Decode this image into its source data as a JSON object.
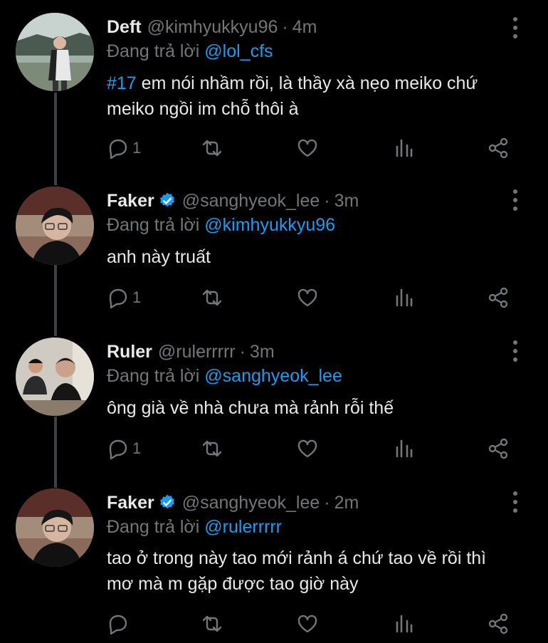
{
  "colors": {
    "background": "#000000",
    "text": "#e7e9ea",
    "muted": "#71767b",
    "accent": "#1d9bf0",
    "thread_line": "#3e4144"
  },
  "tweets": [
    {
      "name": "Deft",
      "verified": false,
      "handle": "@kimhyukkyu96",
      "time": "4m",
      "replying_label": "Đang trả lời",
      "replying_to": "@lol_cfs",
      "hashtag": "#17",
      "text_line1": " em nói nhầm rồi, là thầy xà nẹo meiko chứ",
      "text_line2": "meiko ngồi im chỗ thôi à",
      "reply_count": "1",
      "icons": [
        "reply-icon",
        "retweet-icon",
        "like-icon",
        "views-icon",
        "share-icon"
      ]
    },
    {
      "name": "Faker",
      "verified": true,
      "handle": "@sanghyeok_lee",
      "time": "3m",
      "replying_label": "Đang trả lời",
      "replying_to": "@kimhyukkyu96",
      "text_line1": "anh này truất",
      "reply_count": "1",
      "icons": [
        "reply-icon",
        "retweet-icon",
        "like-icon",
        "views-icon",
        "share-icon"
      ]
    },
    {
      "name": "Ruler",
      "verified": false,
      "handle": "@rulerrrrr",
      "time": "3m",
      "replying_label": "Đang trả lời",
      "replying_to": "@sanghyeok_lee",
      "text_line1": "ông già về nhà chưa mà rảnh rỗi thế",
      "reply_count": "1",
      "icons": [
        "reply-icon",
        "retweet-icon",
        "like-icon",
        "views-icon",
        "share-icon"
      ]
    },
    {
      "name": "Faker",
      "verified": true,
      "handle": "@sanghyeok_lee",
      "time": "2m",
      "replying_label": "Đang trả lời",
      "replying_to": "@rulerrrrr",
      "text_line1": "tao ở trong này tao mới rảnh á chứ tao về rồi thì",
      "text_line2": "mơ mà m gặp được tao giờ này",
      "reply_count": "",
      "icons": [
        "reply-icon",
        "retweet-icon",
        "like-icon",
        "views-icon",
        "share-icon"
      ]
    }
  ],
  "separator": "·"
}
